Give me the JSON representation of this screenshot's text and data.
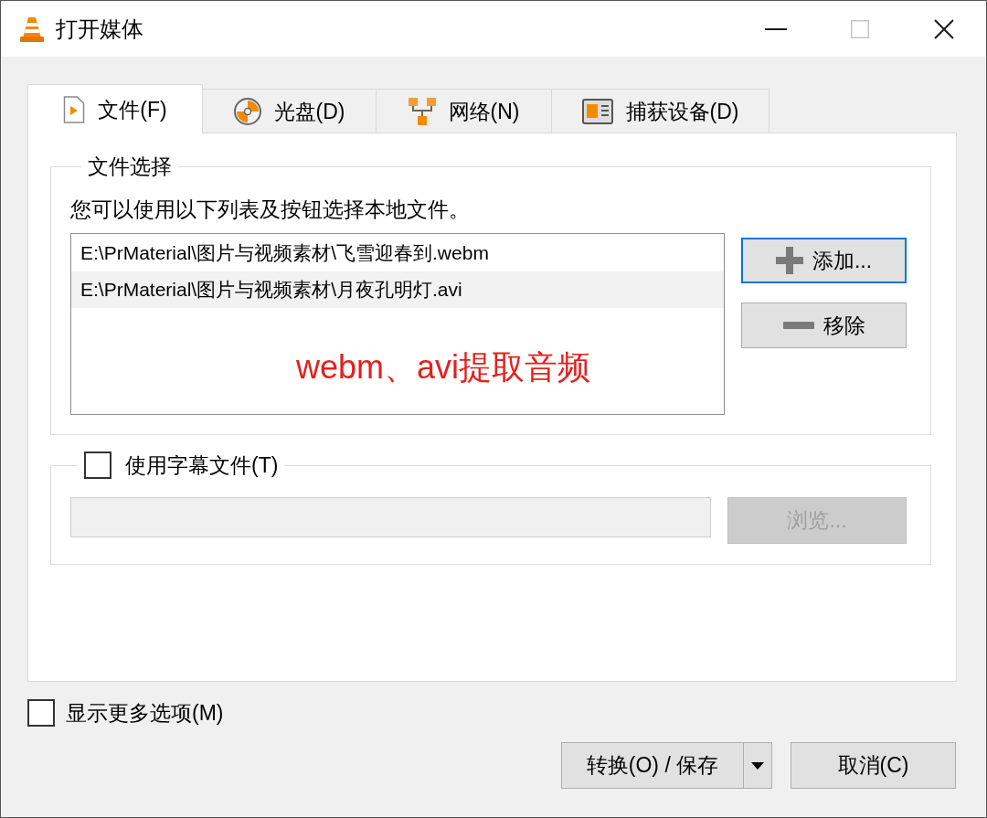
{
  "window": {
    "title": "打开媒体",
    "controls": [
      {
        "kind": "minimize",
        "disabled": false
      },
      {
        "kind": "maximize",
        "disabled": true
      },
      {
        "kind": "close",
        "disabled": false
      }
    ]
  },
  "tabs": [
    {
      "label": "文件(F)",
      "selected": true
    },
    {
      "label": "光盘(D)",
      "selected": false
    },
    {
      "label": "网络(N)",
      "selected": false
    },
    {
      "label": "捕获设备(D)",
      "selected": false
    }
  ],
  "file_selection": {
    "title": "文件选择",
    "hint": "您可以使用以下列表及按钮选择本地文件。",
    "files": [
      {
        "path": "E:\\PrMaterial\\图片与视频素材\\飞雪迎春到.webm",
        "selected": false
      },
      {
        "path": "E:\\PrMaterial\\图片与视频素材\\月夜孔明灯.avi",
        "selected": true
      }
    ],
    "annotation": "webm、avi提取音频",
    "buttons": [
      {
        "label": "添加...",
        "focused": true
      },
      {
        "label": "移除",
        "focused": false
      }
    ]
  },
  "subtitles": {
    "label": "使用字幕文件(T)",
    "checked": false,
    "field_disabled": true,
    "browse": {
      "label": "浏览...",
      "disabled": true
    }
  },
  "more_options": {
    "label": "显示更多选项(M)",
    "checked": false
  },
  "actions": [
    {
      "kind": "split",
      "label": "转换(O) / 保存"
    },
    {
      "kind": "plain",
      "label": "取消(C)"
    }
  ]
}
